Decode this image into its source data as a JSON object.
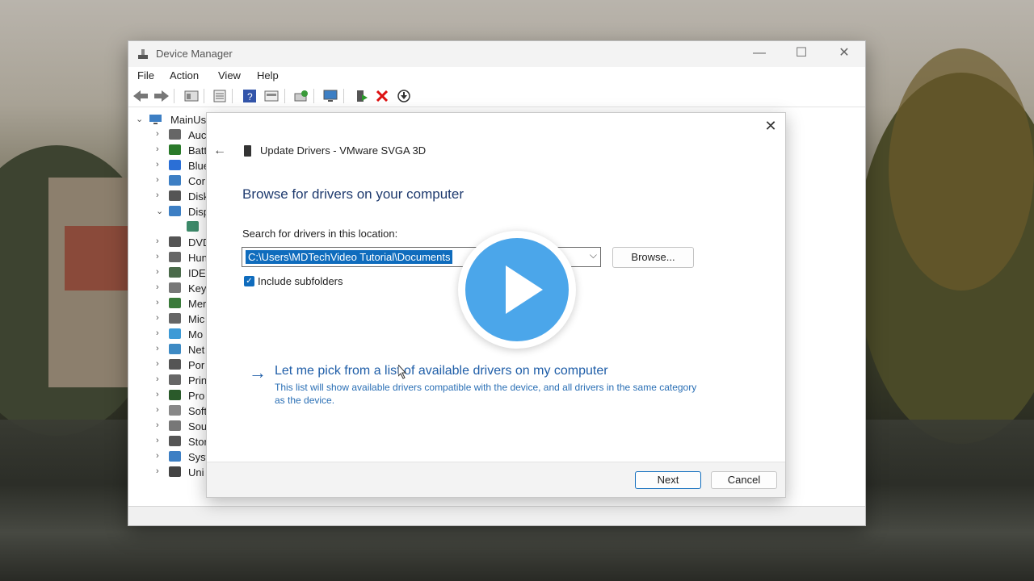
{
  "window": {
    "title": "Device Manager",
    "controls": {
      "minimize": "—",
      "maximize": "☐",
      "close": "✕"
    }
  },
  "menu": [
    "File",
    "Action",
    "View",
    "Help"
  ],
  "toolbar_icons": [
    "back-arrow-icon",
    "forward-arrow-icon",
    "properties-icon",
    "list-icon",
    "help-icon",
    "view-icon",
    "scan-icon",
    "monitor-icon",
    "update-driver-icon",
    "uninstall-icon",
    "download-icon"
  ],
  "tree": {
    "root": "MainUs",
    "items": [
      {
        "label": "Auc",
        "icon": "audio-icon",
        "expanded": false
      },
      {
        "label": "Batt",
        "icon": "battery-icon",
        "expanded": false
      },
      {
        "label": "Blue",
        "icon": "bluetooth-icon",
        "expanded": false
      },
      {
        "label": "Cor",
        "icon": "computer-icon",
        "expanded": false
      },
      {
        "label": "Disk",
        "icon": "disk-icon",
        "expanded": false
      },
      {
        "label": "Disp",
        "icon": "display-icon",
        "expanded": true
      },
      {
        "label": "",
        "icon": "display-adapter-icon",
        "expanded": null
      },
      {
        "label": "DVD",
        "icon": "dvd-icon",
        "expanded": false
      },
      {
        "label": "Hun",
        "icon": "hid-icon",
        "expanded": false
      },
      {
        "label": "IDE",
        "icon": "ide-icon",
        "expanded": false
      },
      {
        "label": "Key",
        "icon": "keyboard-icon",
        "expanded": false
      },
      {
        "label": "Mer",
        "icon": "memory-icon",
        "expanded": false
      },
      {
        "label": "Mic",
        "icon": "mouse-icon",
        "expanded": false
      },
      {
        "label": "Mo",
        "icon": "monitor-icon",
        "expanded": false
      },
      {
        "label": "Net",
        "icon": "network-icon",
        "expanded": false
      },
      {
        "label": "Por",
        "icon": "port-icon",
        "expanded": false
      },
      {
        "label": "Prin",
        "icon": "printer-icon",
        "expanded": false
      },
      {
        "label": "Pro",
        "icon": "processor-icon",
        "expanded": false
      },
      {
        "label": "Soft",
        "icon": "software-icon",
        "expanded": false
      },
      {
        "label": "Sou",
        "icon": "sound-icon",
        "expanded": false
      },
      {
        "label": "Stor",
        "icon": "storage-icon",
        "expanded": false
      },
      {
        "label": "Syst",
        "icon": "system-icon",
        "expanded": false
      },
      {
        "label": "Uni",
        "icon": "usb-icon",
        "expanded": false
      }
    ]
  },
  "dialog": {
    "title": "Update Drivers - VMware SVGA 3D",
    "heading": "Browse for drivers on your computer",
    "search_label": "Search for drivers in this location:",
    "path_value": "C:\\Users\\MDTechVideo Tutorial\\Documents",
    "browse_label": "Browse...",
    "include_subfolders_label": "Include subfolders",
    "include_subfolders_checked": true,
    "pick_link": "Let me pick from a list of available drivers on my computer",
    "pick_desc": "This list will show available drivers compatible with the device, and all drivers in the same category as the device.",
    "next_label": "Next",
    "cancel_label": "Cancel",
    "close": "✕",
    "back": "←"
  },
  "colors": {
    "accent": "#0f6cbd",
    "link": "#1f5ea8",
    "play_button": "#4ba6ea"
  }
}
